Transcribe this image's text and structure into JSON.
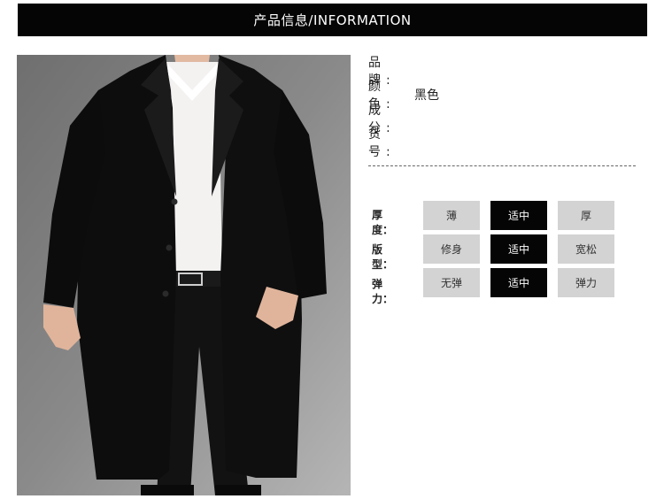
{
  "header": {
    "title": "产品信息/INFORMATION"
  },
  "product_info": [
    {
      "label": "品 牌:",
      "value": ""
    },
    {
      "label": "颜 色:",
      "value": "黑色"
    },
    {
      "label": "成 分:",
      "value": ""
    },
    {
      "label": "货 号:",
      "value": ""
    }
  ],
  "attributes": {
    "rows": [
      {
        "label": "厚度：",
        "options": [
          "薄",
          "适中",
          "厚"
        ],
        "selected": "适中"
      },
      {
        "label": "版型：",
        "options": [
          "修身",
          "适中",
          "宽松"
        ],
        "selected": "适中"
      },
      {
        "label": "弹力：",
        "options": [
          "无弹",
          "适中",
          "弹力"
        ],
        "selected": "适中"
      }
    ]
  },
  "colors": {
    "header_bg": "#050505",
    "selected_bg": "#050505",
    "option_bg": "#d3d3d3"
  }
}
